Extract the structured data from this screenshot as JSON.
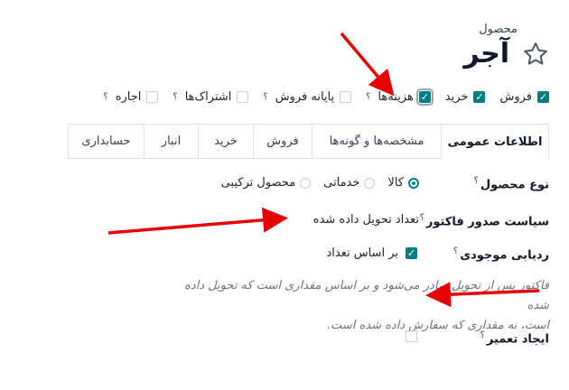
{
  "product_label": "محصول",
  "product_name": "آجر",
  "top_options": [
    {
      "label": "فروش",
      "checked": true,
      "help": ""
    },
    {
      "label": "خرید",
      "checked": true,
      "help": ""
    },
    {
      "label": "هزینه‌ها",
      "checked": true,
      "help": "؟"
    },
    {
      "label": "پایانه فروش",
      "checked": false,
      "help": "؟"
    },
    {
      "label": "اشتراک‌ها",
      "checked": false,
      "help": "؟"
    },
    {
      "label": "اجاره",
      "checked": false,
      "help": "؟"
    }
  ],
  "tabs": [
    "اطلاعات عمومی",
    "مشخصه‌ها و گونه‌ها",
    "فروش",
    "خرید",
    "انبار",
    "حسابداری"
  ],
  "active_tab": "اطلاعات عمومی",
  "form": {
    "product_type": {
      "label": "نوع محصول",
      "help": "؟",
      "options": [
        "کالا",
        "خدماتی",
        "محصول ترکیبی"
      ],
      "selected": "کالا"
    },
    "invoice_policy": {
      "label": "سیاست صدور فاکتور",
      "help": "؟",
      "value": "تعداد تحویل داده شده"
    },
    "inventory": {
      "label": "ردیابی موجودی",
      "help": "؟",
      "checked": true,
      "value": "بر اساس تعداد"
    },
    "help_text_line1": "فاکتور پس از تحویل صادر می‌شود و بر اساس مقداری است که تحویل داده شده",
    "help_text_line2": "است، نه مقداری که سفارش داده شده است.",
    "repair": {
      "label": "ایجاد تعمیر",
      "help": "؟",
      "checked": false
    }
  },
  "colors": {
    "accent": "#017e84",
    "annotation": "#e60000"
  }
}
